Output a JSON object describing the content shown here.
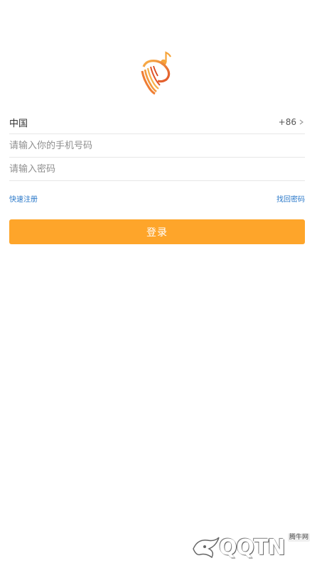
{
  "country": {
    "label": "中国",
    "code": "+86"
  },
  "phone": {
    "placeholder": "请输入你的手机号码",
    "value": ""
  },
  "password": {
    "placeholder": "请输入密码",
    "value": ""
  },
  "links": {
    "register": "快速注册",
    "forgot": "找回密码"
  },
  "login": {
    "label": "登录"
  },
  "watermark": {
    "brand_text": "QQTN",
    "small_text": "腾牛网"
  },
  "icons": {
    "logo": "music-note-logo-icon",
    "chevron": "chevron-right-icon",
    "watermark_logo": "watermark-bird-icon"
  },
  "colors": {
    "accent": "#fea52a",
    "link": "#2a78c9",
    "divider": "#e7e7e7",
    "logo_orange": "#f08c3a",
    "logo_red": "#e05a2a"
  }
}
